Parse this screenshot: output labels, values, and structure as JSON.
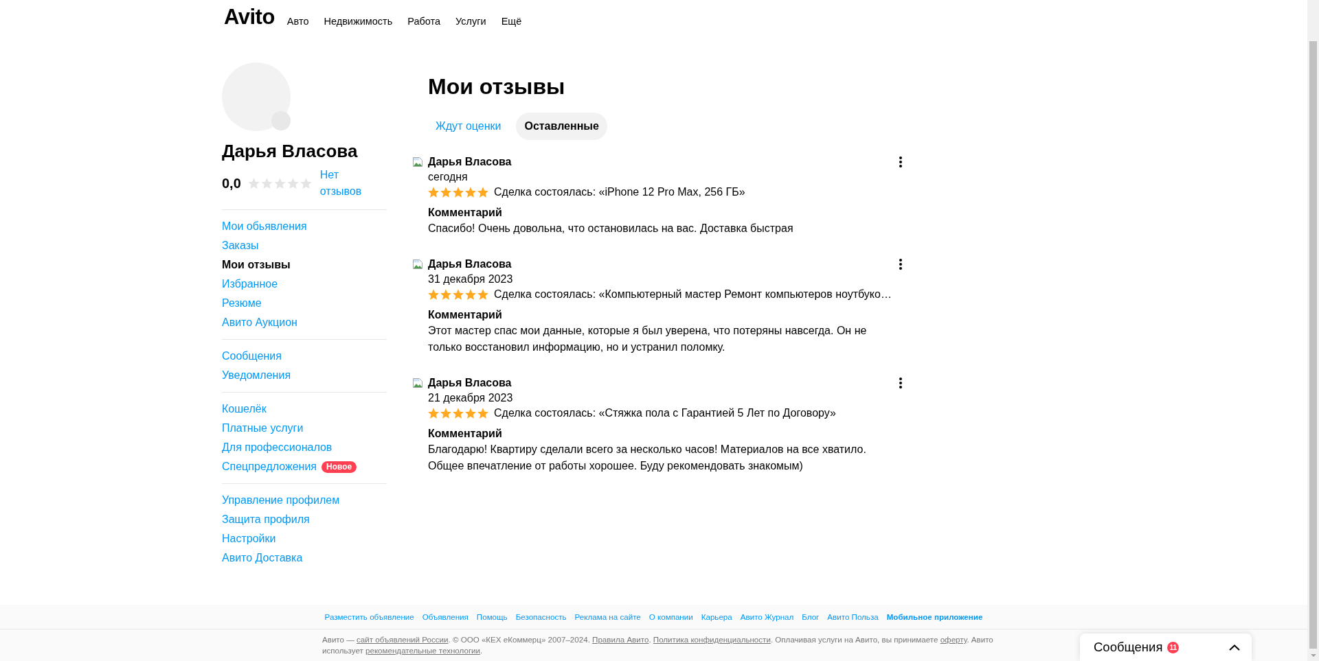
{
  "header": {
    "logo": "Avito",
    "nav": [
      "Авто",
      "Недвижимость",
      "Работа",
      "Услуги",
      "Ещё"
    ]
  },
  "profile": {
    "name": "Дарья Власова",
    "rating": "0,0",
    "stars": 0,
    "reviews_link": "Нет отзывов"
  },
  "sidebar": {
    "groups": [
      {
        "items": [
          {
            "label": "Мои обьявления",
            "selected": false
          },
          {
            "label": "Заказы",
            "selected": false
          },
          {
            "label": "Мои отзывы",
            "selected": true
          },
          {
            "label": "Избранное",
            "selected": false
          },
          {
            "label": "Резюме",
            "selected": false
          },
          {
            "label": "Авито Аукцион",
            "selected": false
          }
        ]
      },
      {
        "items": [
          {
            "label": "Сообщения",
            "selected": false
          },
          {
            "label": "Уведомления",
            "selected": false
          }
        ]
      },
      {
        "items": [
          {
            "label": "Кошелёк",
            "selected": false
          },
          {
            "label": "Платные услуги",
            "selected": false
          },
          {
            "label": "Для профессионалов",
            "selected": false
          },
          {
            "label": "Спецпредложения",
            "selected": false,
            "badge": "Новое"
          }
        ]
      },
      {
        "items": [
          {
            "label": "Управление профилем",
            "selected": false
          },
          {
            "label": "Защита профиля",
            "selected": false
          },
          {
            "label": "Настройки",
            "selected": false
          },
          {
            "label": "Авито Доставка",
            "selected": false
          }
        ]
      }
    ]
  },
  "page": {
    "title": "Мои отзывы",
    "tabs": [
      {
        "label": "Ждут оценки",
        "selected": false
      },
      {
        "label": "Оставленные",
        "selected": true
      }
    ]
  },
  "reviews": [
    {
      "author": "Дарья Власова",
      "date": "сегодня",
      "stars": 5,
      "deal": "Сделка состоялась: «iPhone 12 Pro Max, 256 ГБ»",
      "comment_heading": "Комментарий",
      "comment": "Спасибо! Очень довольна, что остановилась на вас. Доставка быстрая"
    },
    {
      "author": "Дарья Власова",
      "date": "31 декабря 2023",
      "stars": 5,
      "deal": "Сделка состоялась: «Компьютерный мастер Ремонт компьютеров ноутбуко…",
      "comment_heading": "Комментарий",
      "comment": "Этот мастер спас мои данные, которые я был уверена, что потеряны навсегда. Он не только восстановил информацию, но и устранил поломку."
    },
    {
      "author": "Дарья Власова",
      "date": "21 декабря 2023",
      "stars": 5,
      "deal": "Сделка состоялась: «Стяжка пола с Гарантией 5 Лет по Договору»",
      "comment_heading": "Комментарий",
      "comment": "Благодарю! Квартиру сделали всего за несколько часов! Материалов на все хватило. Общее впечатление от работы хорошее. Буду рекомендовать знакомым)"
    }
  ],
  "footer": {
    "links": [
      {
        "label": "Разместить объявление",
        "bold": false
      },
      {
        "label": "Объявления",
        "bold": false
      },
      {
        "label": "Помощь",
        "bold": false
      },
      {
        "label": "Безопасность",
        "bold": false
      },
      {
        "label": "Реклама на сайте",
        "bold": false
      },
      {
        "label": "О компании",
        "bold": false
      },
      {
        "label": "Карьера",
        "bold": false
      },
      {
        "label": "Авито Журнал",
        "bold": false
      },
      {
        "label": "Блог",
        "bold": false
      },
      {
        "label": "Авито Польза",
        "bold": false
      },
      {
        "label": "Мобильное приложение",
        "bold": true
      }
    ],
    "legal": [
      {
        "kind": "text",
        "text": "Авито — "
      },
      {
        "kind": "link",
        "text": "сайт объявлений России"
      },
      {
        "kind": "text",
        "text": ". © ООО «КЕХ еКоммерц» 2007–2024. "
      },
      {
        "kind": "link",
        "text": "Правила Авито"
      },
      {
        "kind": "text",
        "text": ". "
      },
      {
        "kind": "link",
        "text": "Политика конфиденциальности"
      },
      {
        "kind": "text",
        "text": ". Оплачивая услуги на Авито, вы принимаете "
      },
      {
        "kind": "link",
        "text": "оферту"
      },
      {
        "kind": "text",
        "text": ". Авито использует "
      },
      {
        "kind": "link",
        "text": "рекомендательные технологии"
      },
      {
        "kind": "text",
        "text": "."
      }
    ]
  },
  "messages_widget": {
    "label": "Сообщения",
    "unread": "11"
  }
}
